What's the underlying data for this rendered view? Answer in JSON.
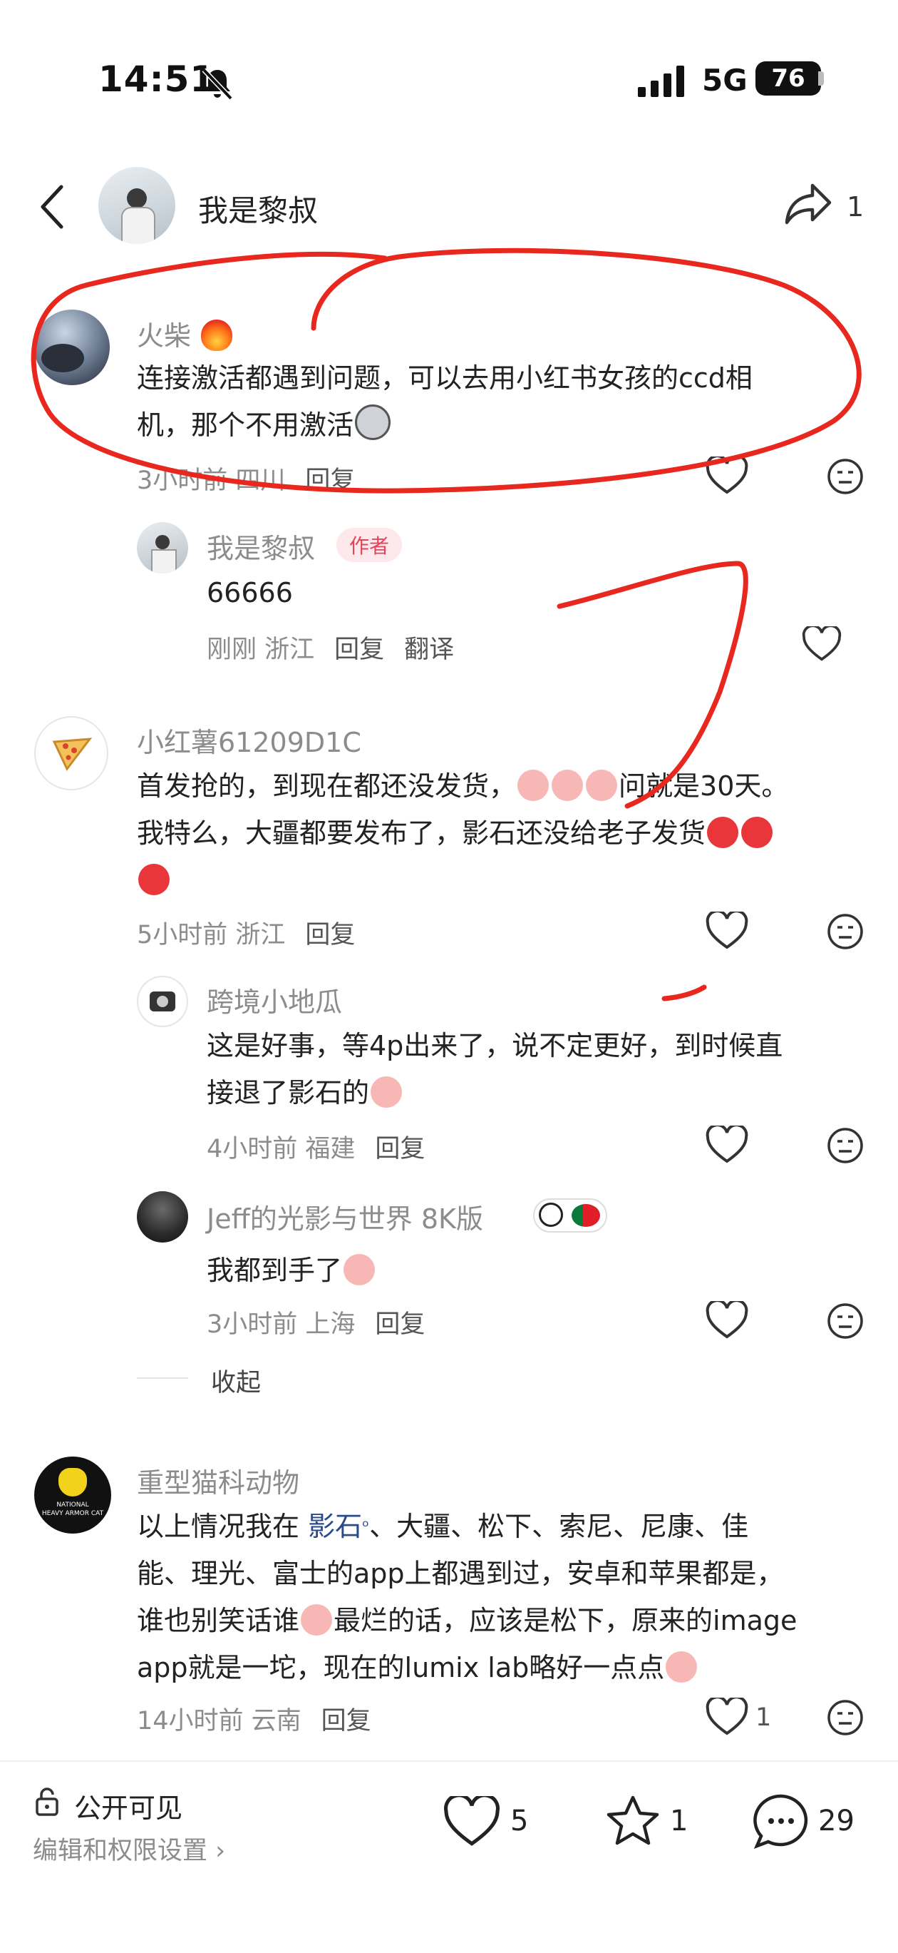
{
  "status_bar": {
    "time": "14:51",
    "network": "5G",
    "battery": "76"
  },
  "header": {
    "title": "我是黎叔",
    "share_count": "1"
  },
  "comments": [
    {
      "name": "火柴",
      "text_line1": "连接激活都遇到问题，可以去用小红书女孩的ccd相",
      "text_line2": "机，那个不用激活",
      "meta": "3小时前 四川",
      "reply_label": "回复",
      "reply": {
        "name": "我是黎叔",
        "badge": "作者",
        "text": "66666",
        "meta": "刚刚 浙江",
        "reply_label": "回复",
        "translate_label": "翻译"
      }
    },
    {
      "name": "小红薯61209D1C",
      "text_line1": "首发抢的，到现在都还没发货，",
      "text_line1b": "问就是30天。",
      "text_line2": "我特么，大疆都要发布了，影石还没给老子发货",
      "meta": "5小时前 浙江",
      "reply_label": "回复",
      "replies": [
        {
          "name": "跨境小地瓜",
          "text_line1": "这是好事，等4p出来了，说不定更好，到时候直",
          "text_line2": "接退了影石的",
          "meta": "4小时前 福建",
          "reply_label": "回复"
        },
        {
          "name": "Jeff的光影与世界 8K版",
          "text_line1": "我都到手了",
          "meta": "3小时前 上海",
          "reply_label": "回复"
        }
      ],
      "collapse_label": "收起"
    },
    {
      "name": "重型猫科动物",
      "text_line1a": "以上情况我在",
      "text_link": "影石",
      "text_line1b": "、大疆、松下、索尼、尼康、佳",
      "text_line2": "能、理光、富士的app上都遇到过，安卓和苹果都是，",
      "text_line3a": "谁也别笑话谁",
      "text_line3b": "最烂的话，应该是松下，原来的image",
      "text_line4": "app就是一坨，现在的lumix lab略好一点点",
      "meta": "14小时前 云南",
      "reply_label": "回复",
      "like_count": "1",
      "avatar_text_1": "NATIONAL",
      "avatar_text_2": "HEAVY ARMOR CAT"
    }
  ],
  "bottom_bar": {
    "visibility": "公开可见",
    "settings": "编辑和权限设置",
    "likes": "5",
    "stars": "1",
    "comments": "29"
  },
  "colors": {
    "annotation_red": "#e8281e",
    "link_blue": "#2b4a8a",
    "author_badge": "#e0455a"
  }
}
